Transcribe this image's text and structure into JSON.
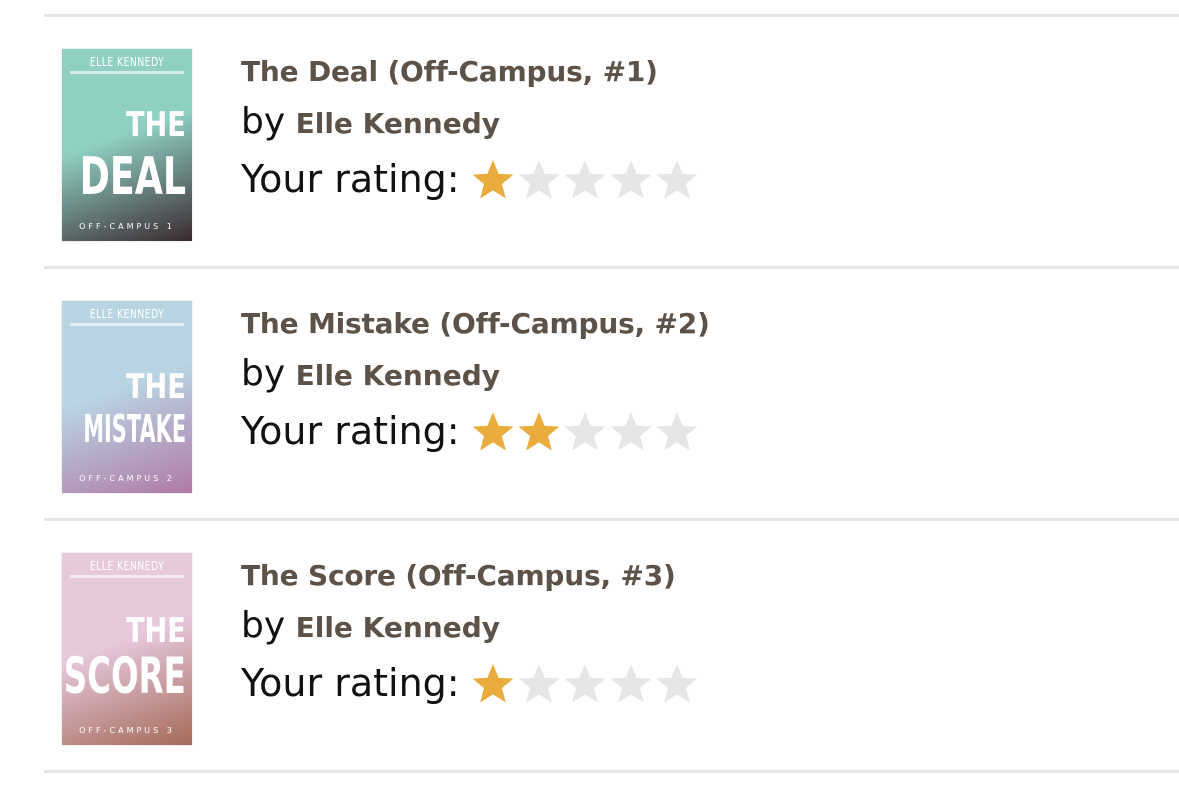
{
  "colors": {
    "star_filled": "#e9ac3d",
    "star_empty": "#e6e6e6",
    "title_color": "#5d5248",
    "divider": "#e6e6e6"
  },
  "books": [
    {
      "title": "The Deal (Off-Campus, #1)",
      "by_label": "by",
      "author": "Elle Kennedy",
      "rating_label": "Your rating:",
      "rating": 1,
      "max_rating": 5,
      "cover": {
        "author_text": "ELLE KENNEDY",
        "title_line1": "THE",
        "title_line2": "DEAL",
        "series_text": "OFF-CAMPUS 1",
        "bg": "#8fcfc4",
        "accent": "#3a2a30",
        "text_color": "#ffffff"
      }
    },
    {
      "title": "The Mistake (Off-Campus, #2)",
      "by_label": "by",
      "author": "Elle Kennedy",
      "rating_label": "Your rating:",
      "rating": 2,
      "max_rating": 5,
      "cover": {
        "author_text": "ELLE KENNEDY",
        "title_line1": "THE",
        "title_line2": "MISTAKE",
        "series_text": "OFF-CAMPUS 2",
        "bg": "#b9d4e3",
        "accent": "#b07aa6",
        "text_color": "#ffffff"
      }
    },
    {
      "title": "The Score (Off-Campus, #3)",
      "by_label": "by",
      "author": "Elle Kennedy",
      "rating_label": "Your rating:",
      "rating": 1,
      "max_rating": 5,
      "cover": {
        "author_text": "ELLE KENNEDY",
        "title_line1": "THE",
        "title_line2": "SCORE",
        "series_text": "OFF-CAMPUS 3",
        "bg": "#e7c9de",
        "accent": "#a56a58",
        "text_color": "#ffffff"
      }
    }
  ]
}
